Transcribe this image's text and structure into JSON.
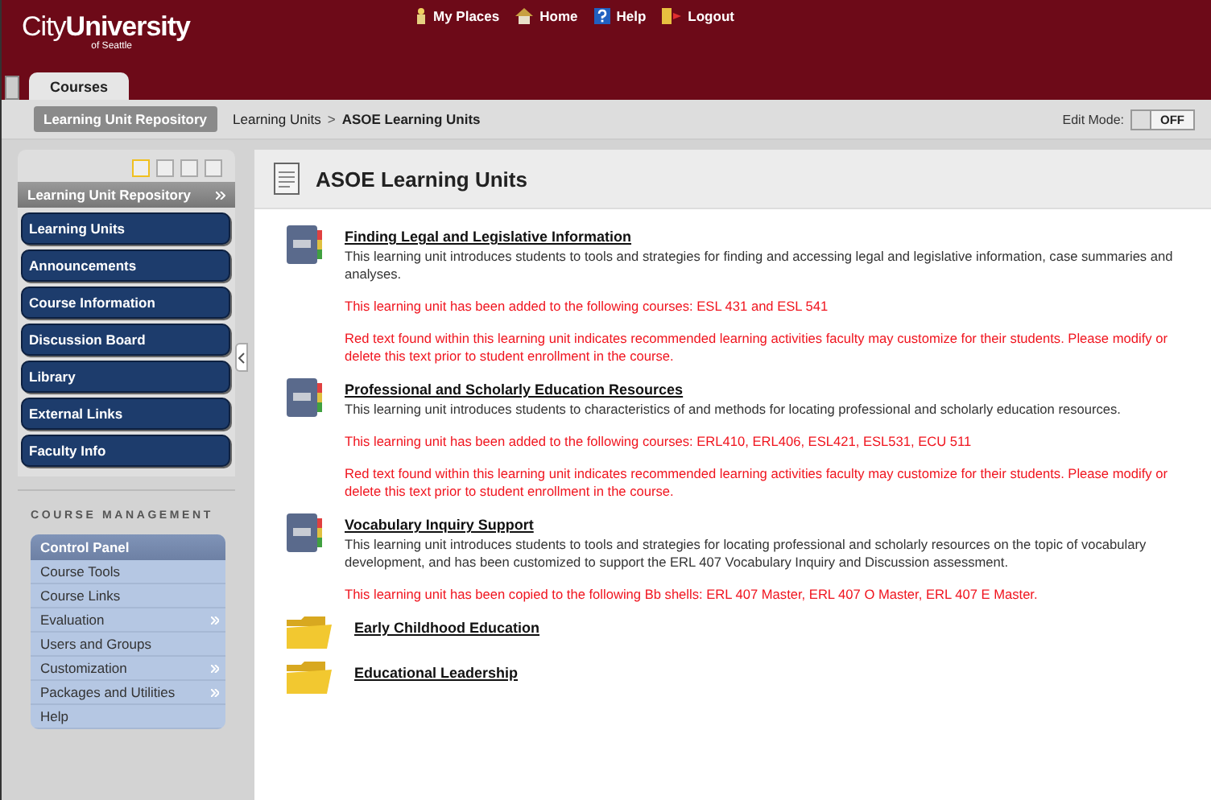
{
  "header": {
    "logo_main": "City",
    "logo_bold": "University",
    "logo_sub": "of Seattle",
    "links": [
      "My Places",
      "Home",
      "Help",
      "Logout"
    ],
    "tabs": [
      {
        "label": "Courses",
        "selected": true
      }
    ]
  },
  "breadcrumb": {
    "root": "Learning Unit Repository",
    "path": [
      "Learning Units",
      "ASOE Learning Units"
    ],
    "separator": ">",
    "edit_mode_label": "Edit Mode:",
    "edit_mode": "OFF"
  },
  "sidebar": {
    "course_title": "Learning Unit Repository",
    "menu": [
      "Learning Units",
      "Announcements",
      "Course Information",
      "Discussion Board",
      "Library",
      "External Links",
      "Faculty Info"
    ],
    "management_title": "COURSE MANAGEMENT",
    "control_panel": {
      "title": "Control Panel",
      "items": [
        {
          "label": "Course Tools",
          "has_submenu": false
        },
        {
          "label": "Course Links",
          "has_submenu": false
        },
        {
          "label": "Evaluation",
          "has_submenu": true
        },
        {
          "label": "Users and Groups",
          "has_submenu": false
        },
        {
          "label": "Customization",
          "has_submenu": true
        },
        {
          "label": "Packages and Utilities",
          "has_submenu": true
        },
        {
          "label": "Help",
          "has_submenu": false
        }
      ]
    }
  },
  "content": {
    "title": "ASOE Learning Units",
    "items": [
      {
        "kind": "unit",
        "title": "Finding Legal and Legislative Information",
        "paragraphs": [
          {
            "kind": "desc",
            "text": "This learning unit introduces students to tools and strategies for finding and accessing legal and legislative information, case summaries and analyses."
          },
          {
            "kind": "note",
            "text": "This learning unit has been added to the following courses: ESL 431 and ESL 541"
          },
          {
            "kind": "note",
            "text": "Red text found within this learning unit indicates recommended learning activities faculty may customize for their students. Please modify or delete this text prior to student enrollment in the course."
          }
        ]
      },
      {
        "kind": "unit",
        "title": "Professional and Scholarly Education Resources",
        "paragraphs": [
          {
            "kind": "desc",
            "text": "This learning unit introduces students to characteristics of and methods for locating professional and scholarly education resources."
          },
          {
            "kind": "note",
            "text": "This learning unit has been added to the following courses: ERL410, ERL406, ESL421, ESL531, ECU 511"
          },
          {
            "kind": "note",
            "text": "Red text found within this learning unit indicates recommended learning activities faculty may customize for their students. Please modify or delete this text prior to student enrollment in the course."
          }
        ]
      },
      {
        "kind": "unit",
        "title": "Vocabulary Inquiry Support",
        "paragraphs": [
          {
            "kind": "desc",
            "text": "This learning unit introduces students to tools and strategies for locating professional and scholarly resources on the topic of vocabulary development, and has been customized to support the ERL 407 Vocabulary Inquiry and Discussion assessment."
          },
          {
            "kind": "note",
            "text": "This learning unit has been copied to the following Bb shells: ERL 407 Master, ERL 407 O Master, ERL 407 E Master."
          }
        ]
      },
      {
        "kind": "folder",
        "title": "Early Childhood Education"
      },
      {
        "kind": "folder",
        "title": "Educational Leadership"
      }
    ]
  }
}
